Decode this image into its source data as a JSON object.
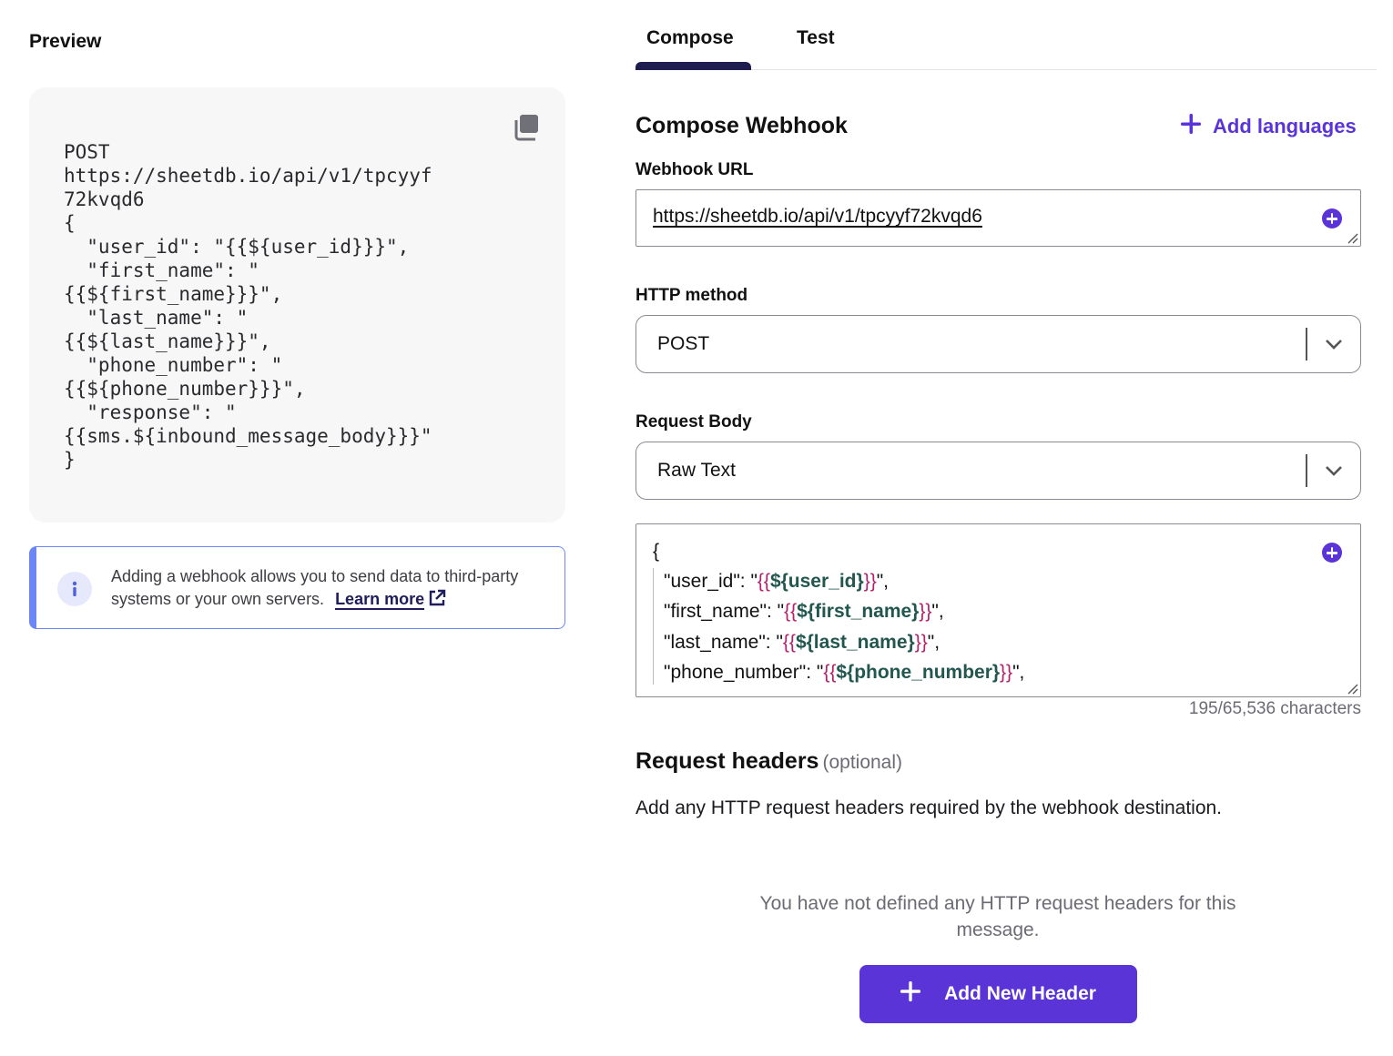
{
  "preview": {
    "title": "Preview",
    "code": "POST\nhttps://sheetdb.io/api/v1/tpcyyf\n72kvqd6\n{\n  \"user_id\": \"{{${user_id}}}\",\n  \"first_name\": \"\n{{${first_name}}}\",\n  \"last_name\": \"\n{{${last_name}}}\",\n  \"phone_number\": \"\n{{${phone_number}}}\",\n  \"response\": \"\n{{sms.${inbound_message_body}}}\"\n}",
    "copy_icon": "copy-icon"
  },
  "info": {
    "text": "Adding a webhook allows you to send data to third-party systems or your own servers.",
    "learn_more": "Learn more",
    "icon": "info-icon"
  },
  "tabs": [
    {
      "label": "Compose",
      "active": true
    },
    {
      "label": "Test",
      "active": false
    }
  ],
  "compose": {
    "title": "Compose Webhook",
    "add_languages": "Add languages",
    "webhook_url_label": "Webhook URL",
    "webhook_url_value": "https://sheetdb.io/api/v1/tpcyyf72kvqd6",
    "http_method_label": "HTTP method",
    "http_method_value": "POST",
    "request_body_label": "Request Body",
    "request_body_value": "Raw Text",
    "body_lines": [
      {
        "key": "{",
        "open": "",
        "var": "",
        "close": "",
        "tail": ""
      },
      {
        "key": "\"user_id\": \"",
        "open": "{{",
        "var": "${user_id}",
        "close": "}}",
        "tail": "\","
      },
      {
        "key": "\"first_name\": \"",
        "open": "{{",
        "var": "${first_name}",
        "close": "}}",
        "tail": "\","
      },
      {
        "key": "\"last_name\": \"",
        "open": "{{",
        "var": "${last_name}",
        "close": "}}",
        "tail": "\","
      },
      {
        "key": "\"phone_number\": \"",
        "open": "{{",
        "var": "${phone_number}",
        "close": "}}",
        "tail": "\","
      }
    ],
    "char_count": "195/65,536 characters"
  },
  "headers": {
    "title": "Request headers",
    "optional": "(optional)",
    "description": "Add any HTTP request headers required by the webhook destination.",
    "empty_message": "You have not defined any HTTP request headers for this message.",
    "add_button": "Add New Header"
  },
  "colors": {
    "accent": "#5b34d8",
    "tab_underline": "#1f1d4f",
    "info_border": "#6c86f5",
    "token_brace": "#b4206b",
    "token_var": "#22574f"
  }
}
